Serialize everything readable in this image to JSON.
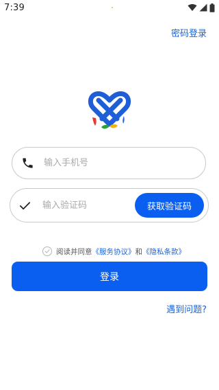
{
  "status_bar": {
    "time": "7:39",
    "icons": [
      "wifi-icon",
      "cellular-signal-icon",
      "battery-icon"
    ]
  },
  "header": {
    "password_login_label": "密码登录"
  },
  "logo": {
    "icon": "heart-logo-icon",
    "colors": {
      "primary": "#1e5fd8",
      "red": "#e53b2f",
      "green": "#2e9e3c",
      "yellow": "#f2b705"
    }
  },
  "phone_field": {
    "icon": "phone-icon",
    "value": "",
    "placeholder": "输入手机号"
  },
  "code_field": {
    "icon": "checkmark-icon",
    "value": "",
    "placeholder": "输入验证码",
    "get_code_label": "获取验证码"
  },
  "agreement": {
    "checked": false,
    "prefix": "阅读并同意",
    "service_link": "《服务协议》",
    "conjunction": "和",
    "privacy_link": "《隐私条款》"
  },
  "login_button": {
    "label": "登录"
  },
  "help": {
    "problem_label": "遇到问题?"
  },
  "theme": {
    "accent": "#0a5ff0",
    "link": "#1a63d8",
    "border": "#c9c9c9",
    "placeholder": "#a9a9a9"
  }
}
